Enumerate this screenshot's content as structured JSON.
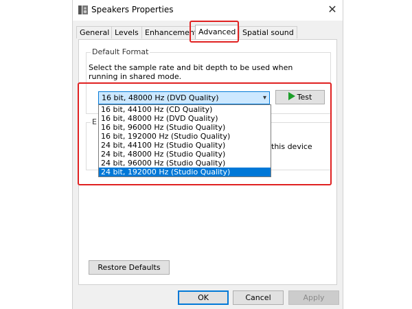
{
  "window": {
    "title": "Speakers Properties",
    "close_glyph": "✕"
  },
  "tabs": [
    {
      "label": "General"
    },
    {
      "label": "Levels"
    },
    {
      "label": "Enhancements"
    },
    {
      "label": "Advanced",
      "active": true
    },
    {
      "label": "Spatial sound"
    }
  ],
  "default_format": {
    "group_label": "Default Format",
    "description": "Select the sample rate and bit depth to be used when running in shared mode.",
    "selected_value": "16 bit, 48000 Hz (DVD Quality)",
    "test_label": "Test",
    "options": [
      "16 bit, 44100 Hz (CD Quality)",
      "16 bit, 48000 Hz (DVD Quality)",
      "16 bit, 96000 Hz (Studio Quality)",
      "16 bit, 192000 Hz (Studio Quality)",
      "24 bit, 44100 Hz (Studio Quality)",
      "24 bit, 48000 Hz (Studio Quality)",
      "24 bit, 96000 Hz (Studio Quality)",
      "24 bit, 192000 Hz (Studio Quality)"
    ],
    "highlighted_option": "24 bit, 192000 Hz (Studio Quality)"
  },
  "exclusive_mode": {
    "label_fragment": "E",
    "text_fragment": "this device"
  },
  "buttons": {
    "restore_defaults": "Restore Defaults",
    "ok": "OK",
    "cancel": "Cancel",
    "apply": "Apply"
  },
  "colors": {
    "highlight_box": "#e02020",
    "selection": "#0078d7",
    "play": "#1c9e2a"
  }
}
